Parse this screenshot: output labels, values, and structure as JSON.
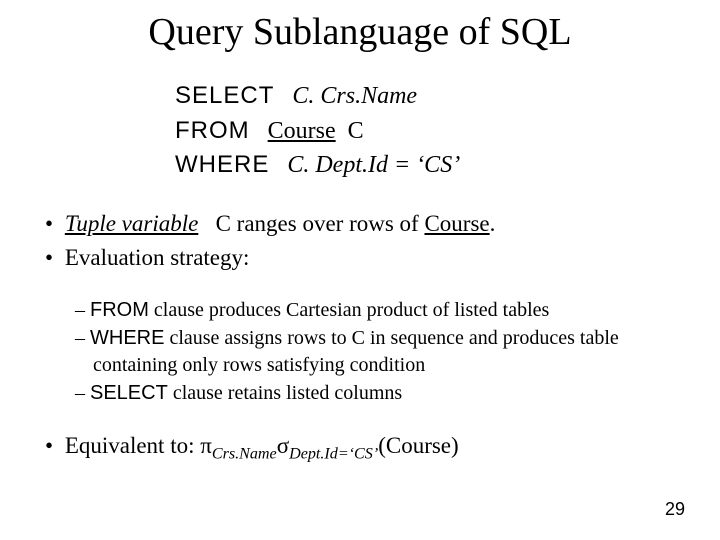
{
  "title": "Query Sublanguage of SQL",
  "query": {
    "select_kw": "SELECT",
    "select_val": "C. Crs.Name",
    "from_kw": "FROM",
    "from_tbl": "Course",
    "from_alias": "C",
    "where_kw": "WHERE",
    "where_cond": "C. Dept.Id = ‘CS’"
  },
  "bullets": {
    "b1_term": "Tuple variable",
    "b1_rest_a": "C ranges over rows of ",
    "b1_rest_b": "Course",
    "b1_rest_c": ".",
    "b2": "Evaluation strategy:",
    "s1a": "FROM",
    "s1b": " clause produces Cartesian product of listed tables",
    "s2a": "WHERE",
    "s2b": " clause assigns rows to C in sequence and produces table containing only rows satisfying condition",
    "s3a": "SELECT",
    "s3b": " clause retains listed columns",
    "b3_a": "Equivalent to:   ",
    "b3_pi": "π",
    "b3_pi_sub": "Crs.Name",
    "b3_sigma": "σ",
    "b3_sigma_sub": "Dept.Id=‘CS’",
    "b3_paren": "(Course)"
  },
  "page_num": "29"
}
